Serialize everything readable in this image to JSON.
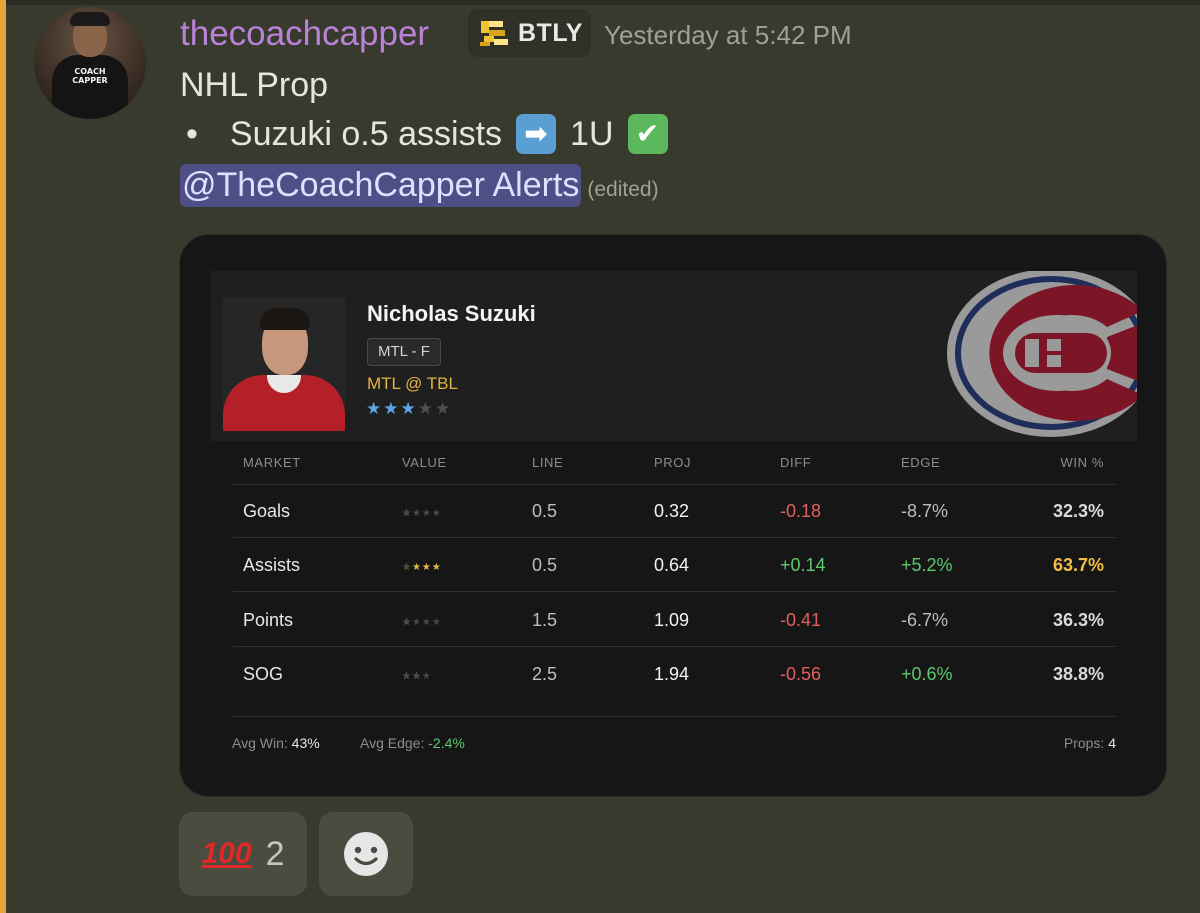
{
  "message": {
    "username": "thecoachcapper",
    "app_tag": "BTLY",
    "timestamp": "Yesterday at 5:42 PM",
    "line1": "NHL Prop",
    "bullet": "•",
    "pick_text": "Suzuki o.5 assists",
    "arrow_emoji": "➡",
    "units": "1U",
    "check_emoji": "✔",
    "mention": "@TheCoachCapper Alerts",
    "edited": "(edited)",
    "avatar_shirt_text": "COACH CAPPER"
  },
  "card": {
    "player_name": "Nicholas Suzuki",
    "position": "MTL - F",
    "matchup": "MTL @ TBL",
    "player_rating": {
      "filled": 3,
      "total": 5
    },
    "columns": {
      "market": "MARKET",
      "value": "VALUE",
      "line": "LINE",
      "proj": "PROJ",
      "diff": "DIFF",
      "edge": "EDGE",
      "win": "WIN %"
    },
    "rows": [
      {
        "market": "Goals",
        "value_stars": 1,
        "line": "0.5",
        "proj": "0.32",
        "diff": "-0.18",
        "edge": "-8.7%",
        "win": "32.3%"
      },
      {
        "market": "Assists",
        "value_stars": 4,
        "line": "0.5",
        "proj": "0.64",
        "diff": "+0.14",
        "edge": "+5.2%",
        "win": "63.7%"
      },
      {
        "market": "Points",
        "value_stars": 1,
        "line": "1.5",
        "proj": "1.09",
        "diff": "-0.41",
        "edge": "-6.7%",
        "win": "36.3%"
      },
      {
        "market": "SOG",
        "value_stars": 2,
        "line": "2.5",
        "proj": "1.94",
        "diff": "-0.56",
        "edge": "+0.6%",
        "win": "38.8%"
      }
    ],
    "footer": {
      "avg_win_label": "Avg Win:",
      "avg_win": "43%",
      "avg_edge_label": "Avg Edge:",
      "avg_edge": "-2.4%",
      "props_label": "Props:",
      "props": "4"
    }
  },
  "reactions": [
    {
      "emoji": "100",
      "count": "2"
    }
  ],
  "colors": {
    "username": "#b982d6",
    "accent_bar": "#e9a33a",
    "positive": "#5cc96c",
    "negative": "#e0605d",
    "highlight": "#f2bd42"
  }
}
